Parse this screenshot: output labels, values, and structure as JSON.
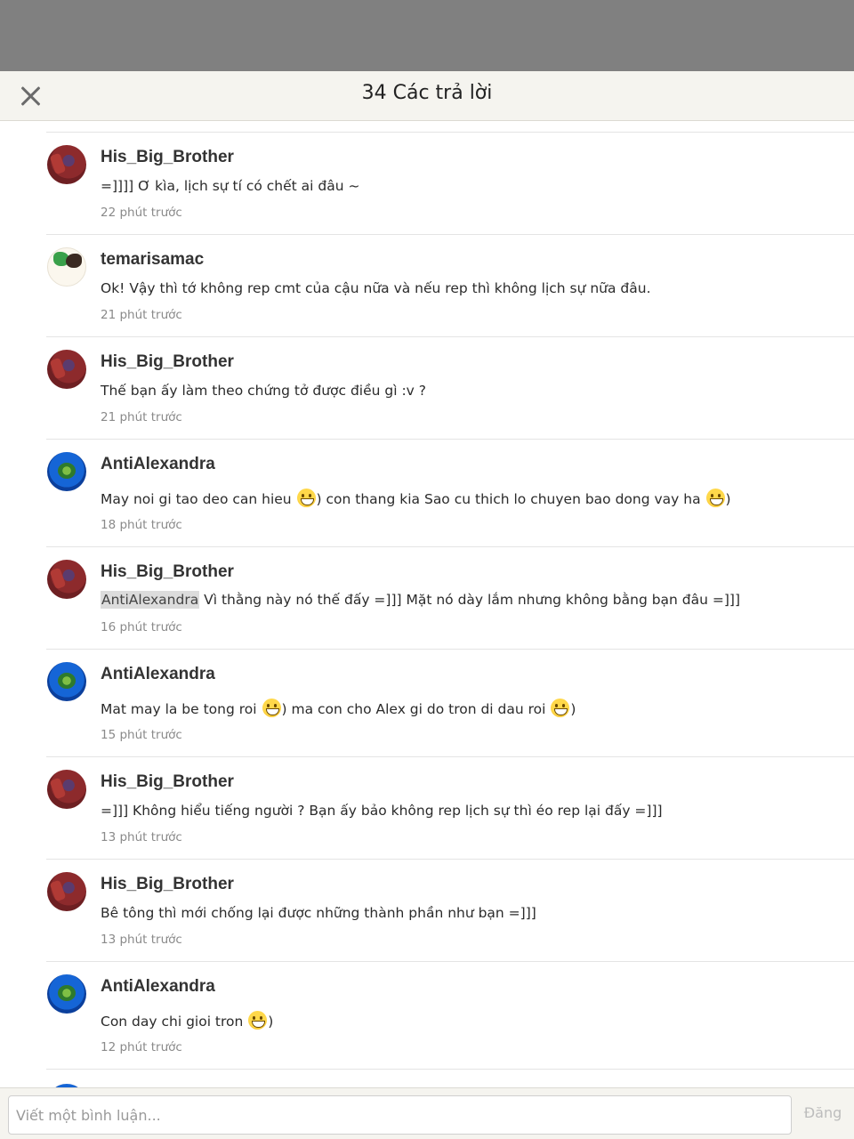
{
  "header": {
    "title": "34 Các trả lời",
    "close_icon": "close-icon"
  },
  "comments": [
    {
      "username": "His_Big_Brother",
      "avatar": "red-character-avatar",
      "text": "=]]]] Ơ kìa, lịch sự tí có chết ai đâu ~",
      "time": "22 phút trước"
    },
    {
      "username": "temarisamac",
      "avatar": "anime-duo-avatar",
      "text": "Ok! Vậy thì tớ không  rep cmt của cậu nữa và nếu rep thì không lịch sự nữa đâu.",
      "time": "21 phút trước"
    },
    {
      "username": "His_Big_Brother",
      "avatar": "red-character-avatar",
      "text": "Thế bạn ấy làm theo chứng tở được điều gì :v ?",
      "time": "21 phút trước"
    },
    {
      "username": "AntiAlexandra",
      "avatar": "blue-flower-avatar",
      "text_parts": [
        "May noi gi tao deo can hieu ",
        ") con thang kia Sao cu thich lo chuyen bao dong vay ha ",
        ")"
      ],
      "emoji": "grinning-face-emoji",
      "time": "18 phút trước"
    },
    {
      "username": "His_Big_Brother",
      "avatar": "red-character-avatar",
      "mention": "AntiAlexandra",
      "text": " Vì thằng này nó thế đấy =]]] Mặt nó dày lắm nhưng không bằng bạn đâu =]]]",
      "time": "16 phút trước"
    },
    {
      "username": "AntiAlexandra",
      "avatar": "blue-flower-avatar",
      "text_parts": [
        "Mat may la be tong roi ",
        ") ma con cho Alex gi do tron di dau roi ",
        ")"
      ],
      "emoji": "grinning-face-emoji",
      "time": "15 phút trước"
    },
    {
      "username": "His_Big_Brother",
      "avatar": "red-character-avatar",
      "text": "=]]] Không hiểu tiếng người ? Bạn ấy bảo không rep lịch sự thì éo rep lại đấy =]]]",
      "time": "13 phút trước"
    },
    {
      "username": "His_Big_Brother",
      "avatar": "red-character-avatar",
      "text": "Bê tông thì mới chống lại được những thành phần như bạn =]]]",
      "time": "13 phút trước"
    },
    {
      "username": "AntiAlexandra",
      "avatar": "blue-flower-avatar",
      "text_parts": [
        "Con day chi gioi tron ",
        ")"
      ],
      "emoji": "grinning-face-emoji",
      "time": "12 phút trước"
    }
  ],
  "footer": {
    "input_placeholder": "Viết một bình luận...",
    "post_label": "Đăng"
  },
  "colors": {
    "overlay": "#808080",
    "header_bg": "#f5f4ef",
    "username": "#333333",
    "timestamp": "#8a8a8a",
    "mention_bg": "#dcdcdc",
    "post_disabled": "#bdbdbd"
  }
}
